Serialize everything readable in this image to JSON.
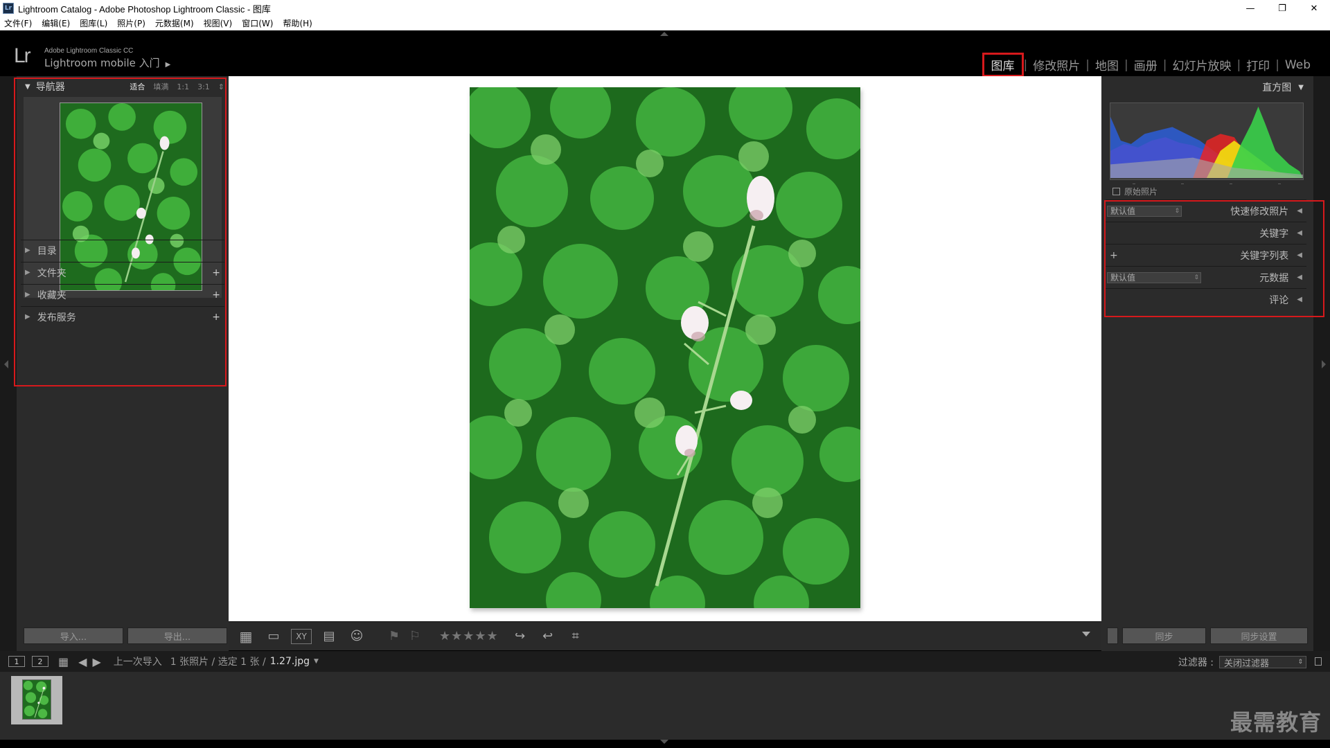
{
  "window": {
    "title": "Lightroom Catalog - Adobe Photoshop Lightroom Classic - 图库",
    "icon": "Lr",
    "controls": [
      "—",
      "❐",
      "✕"
    ]
  },
  "menu": [
    "文件(F)",
    "编辑(E)",
    "图库(L)",
    "照片(P)",
    "元数据(M)",
    "视图(V)",
    "窗口(W)",
    "帮助(H)"
  ],
  "header": {
    "logo": "Lr",
    "product": "Adobe Lightroom Classic CC",
    "mobile": "Lightroom mobile 入门",
    "modules": [
      "图库",
      "修改照片",
      "地图",
      "画册",
      "幻灯片放映",
      "打印",
      "Web"
    ],
    "active_module": "图库"
  },
  "left_panel": {
    "navigator": {
      "title": "导航器",
      "zoom_options": [
        "适合",
        "填满",
        "1:1",
        "3:1"
      ],
      "zoom_selected": "适合"
    },
    "sections": [
      {
        "label": "目录",
        "plus": ""
      },
      {
        "label": "文件夹",
        "plus": "+"
      },
      {
        "label": "收藏夹",
        "plus": "+"
      },
      {
        "label": "发布服务",
        "plus": "+"
      }
    ],
    "import_label": "导入...",
    "export_label": "导出..."
  },
  "right_panel": {
    "histogram_title": "直方图",
    "histogram_ticks": [
      "–",
      "–",
      "–",
      "–"
    ],
    "original_photo": "原始照片",
    "sections": [
      {
        "dropdown": "默认值",
        "label": "快速修改照片",
        "plus": ""
      },
      {
        "dropdown": "",
        "label": "关键字",
        "plus": ""
      },
      {
        "dropdown": "",
        "label": "关键字列表",
        "plus": "+"
      },
      {
        "dropdown": "默认值",
        "label": "元数据",
        "plus": ""
      },
      {
        "dropdown": "",
        "label": "评论",
        "plus": ""
      }
    ],
    "sync_label": "同步",
    "sync_settings_label": "同步设置"
  },
  "toolbar": {
    "stars": "★★★★★",
    "xy_label": "XY"
  },
  "filmstrip": {
    "monitor1": "1",
    "monitor2": "2",
    "source": "上一次导入",
    "info": "1 张照片 / 选定 1 张 /",
    "file": "1.27.jpg",
    "filter_label": "过滤器 :",
    "filter_value": "关闭过滤器"
  },
  "watermark": "最需教育",
  "colors": {
    "highlight_box": "#d7191c",
    "panel_bg": "#2b2b2b",
    "canvas_bg": "#ffffff"
  }
}
